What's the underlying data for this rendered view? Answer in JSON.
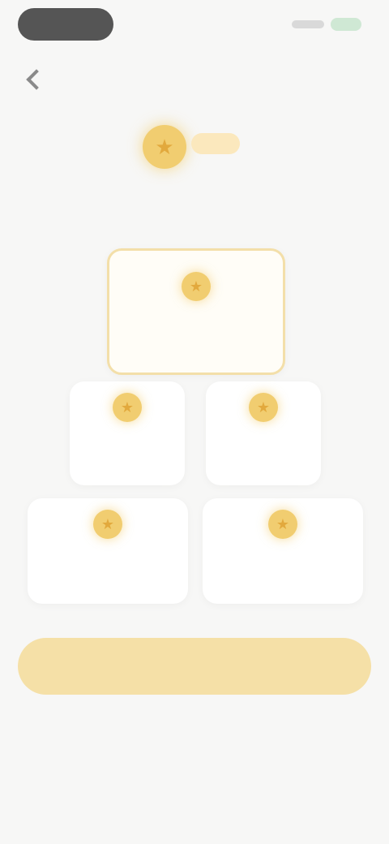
{
  "status_bar": {
    "time": ""
  },
  "nav": {
    "title": "",
    "back_icon": "chevron-left-icon"
  },
  "hero": {
    "icon": "coin-icon",
    "coin_glyph": "★"
  },
  "header": {
    "title": "",
    "subtitle": ""
  },
  "plans": [
    {
      "amount": "",
      "price": "",
      "featured": true
    },
    {
      "amount": "",
      "price": "",
      "featured": false
    },
    {
      "amount": "",
      "price": "",
      "featured": false
    },
    {
      "amount": "",
      "price": "",
      "featured": false
    },
    {
      "amount": "",
      "price": "",
      "featured": false
    }
  ],
  "cta": {
    "label": ""
  },
  "footer": {
    "note": "",
    "links": [
      "",
      ""
    ],
    "legal": ""
  },
  "colors": {
    "accent": "#f1cd70",
    "button": "#f5e0a7",
    "background": "#f7f7f6"
  }
}
